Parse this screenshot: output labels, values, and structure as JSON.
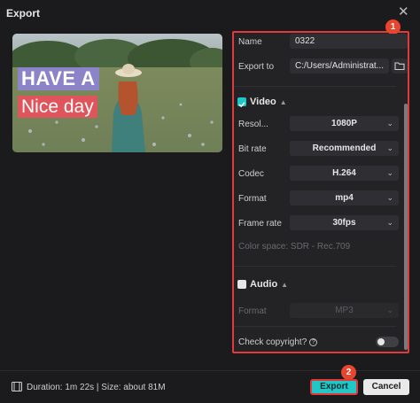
{
  "window": {
    "title": "Export"
  },
  "preview": {
    "caption_line1": "HAVE A",
    "caption_line2": "Nice day"
  },
  "badges": {
    "panel": "1",
    "export": "2"
  },
  "name": {
    "label": "Name",
    "value": "0322"
  },
  "export_to": {
    "label": "Export to",
    "value": "C:/Users/Administrat..."
  },
  "video": {
    "title": "Video",
    "enabled": true,
    "rows": [
      {
        "label": "Resol...",
        "value": "1080P"
      },
      {
        "label": "Bit rate",
        "value": "Recommended"
      },
      {
        "label": "Codec",
        "value": "H.264"
      },
      {
        "label": "Format",
        "value": "mp4"
      },
      {
        "label": "Frame rate",
        "value": "30fps"
      }
    ],
    "color_space": "Color space: SDR - Rec.709"
  },
  "audio": {
    "title": "Audio",
    "enabled": false,
    "format_label": "Format",
    "format_value": "MP3"
  },
  "copyright": {
    "label": "Check copyright?",
    "enabled": false
  },
  "footer": {
    "info": "Duration: 1m 22s | Size: about 81M"
  },
  "buttons": {
    "export": "Export",
    "cancel": "Cancel"
  },
  "colors": {
    "accent": "#21c6c6",
    "highlight": "#e23a3a",
    "badge": "#e8452f"
  }
}
